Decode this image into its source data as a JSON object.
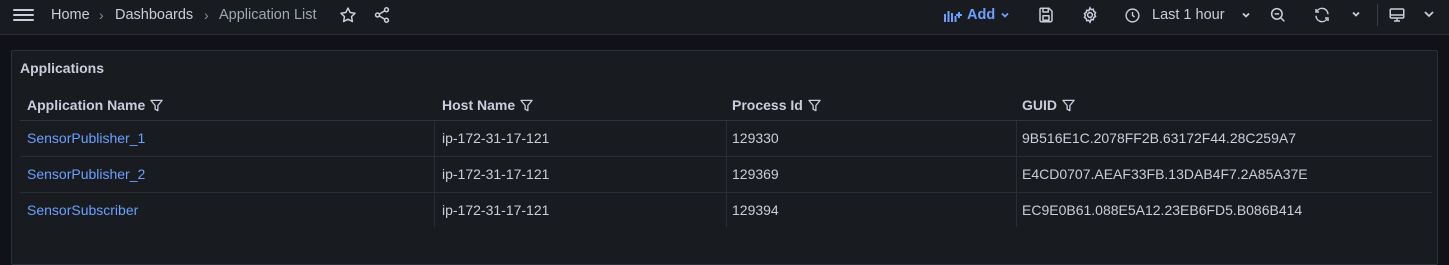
{
  "breadcrumb": {
    "home": "Home",
    "separator": "›",
    "dashboards": "Dashboards",
    "current": "Application List"
  },
  "toolbar": {
    "add_label": "Add",
    "time_range": "Last 1 hour",
    "accent_color": "#6e9fff"
  },
  "panel": {
    "title": "Applications",
    "columns": [
      "Application Name",
      "Host Name",
      "Process Id",
      "GUID"
    ],
    "rows": [
      {
        "app": "SensorPublisher_1",
        "host": "ip-172-31-17-121",
        "pid": "129330",
        "guid": "9B516E1C.2078FF2B.63172F44.28C259A7"
      },
      {
        "app": "SensorPublisher_2",
        "host": "ip-172-31-17-121",
        "pid": "129369",
        "guid": "E4CD0707.AEAF33FB.13DAB4F7.2A85A37E"
      },
      {
        "app": "SensorSubscriber",
        "host": "ip-172-31-17-121",
        "pid": "129394",
        "guid": "EC9E0B61.088E5A12.23EB6FD5.B086B414"
      }
    ]
  }
}
